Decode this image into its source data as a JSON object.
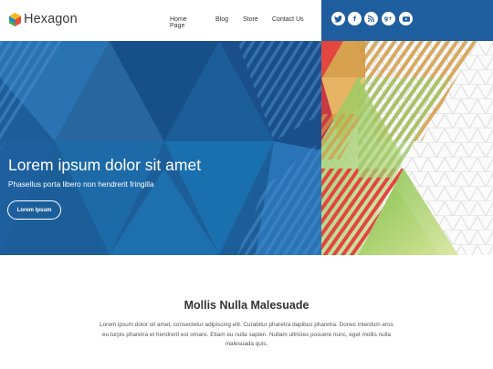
{
  "brand": {
    "name": "Hexagon"
  },
  "nav": {
    "items": [
      {
        "label": "Home Page"
      },
      {
        "label": "Blog"
      },
      {
        "label": "Store"
      },
      {
        "label": "Contact Us"
      }
    ]
  },
  "social": {
    "icons": [
      {
        "name": "twitter-icon",
        "glyph": "t"
      },
      {
        "name": "facebook-icon",
        "glyph": "f"
      },
      {
        "name": "rss-icon",
        "glyph": "≈"
      },
      {
        "name": "google-plus-icon",
        "glyph": "g+"
      },
      {
        "name": "youtube-icon",
        "glyph": "▶"
      }
    ]
  },
  "hero": {
    "title": "Lorem ipsum dolor sit amet",
    "subtitle": "Phasellus porta libero non hendrerit fringilla",
    "button_label": "Lorem Ipsum"
  },
  "section": {
    "title": "Mollis Nulla Malesuade",
    "text": "Lorem ipsum dolor sit amet, consectetur adipiscing elit. Curabitur pharetra dapibus pharetra. Donec interdum eros eu turpis pharetra et hendrerit est ornare. Etiam eu nulla sapien. Nullam ultricies posuere nunc, eget mollis nulla malesuada quis."
  },
  "colors": {
    "brand_blue": "#1f5e9e",
    "hero_blue": "#1b5c97",
    "accent_red": "#e0463f",
    "accent_green": "#8bc34a",
    "accent_gold": "#d6a64e"
  }
}
